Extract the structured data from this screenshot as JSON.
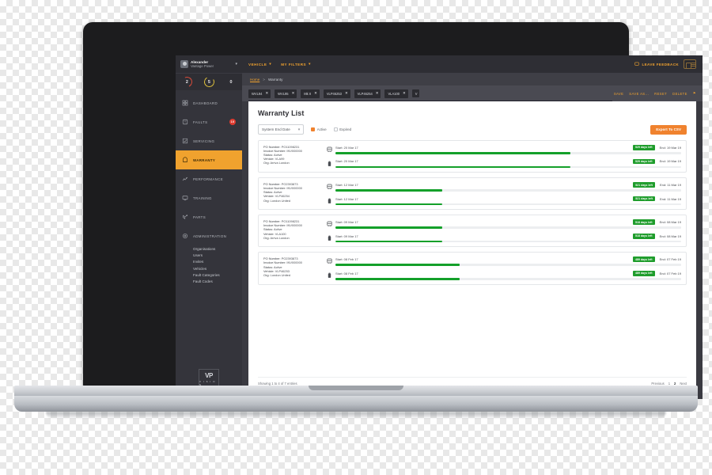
{
  "sidebar": {
    "user": {
      "name": "Alexander",
      "org": "Vantage Power",
      "caret": "chevron-down"
    },
    "gauges": [
      {
        "value": "2",
        "color": "#d94b3a"
      },
      {
        "value": "5",
        "color": "#e0c13c"
      },
      {
        "value": "0",
        "color": "#34343b"
      }
    ],
    "items": [
      {
        "label": "DASHBOARD",
        "icon": "dashboard-icon",
        "badge": ""
      },
      {
        "label": "FAULTS",
        "icon": "faults-icon",
        "badge": "10"
      },
      {
        "label": "SERVICING",
        "icon": "servicing-icon",
        "badge": ""
      },
      {
        "label": "WARRANTY",
        "icon": "warranty-icon",
        "badge": ""
      },
      {
        "label": "PERFORMANCE",
        "icon": "performance-icon",
        "badge": ""
      },
      {
        "label": "TRAINING",
        "icon": "training-icon",
        "badge": ""
      },
      {
        "label": "PARTS",
        "icon": "parts-icon",
        "badge": ""
      },
      {
        "label": "ADMINISTRATION",
        "icon": "gear-icon",
        "badge": ""
      }
    ],
    "subnav": [
      "Organisations",
      "Users",
      "Invites",
      "Vehicles",
      "Fault Categories",
      "Fault Codes"
    ],
    "logo": {
      "mark": "VP",
      "wordmark": "V I S I O N"
    }
  },
  "topbar": {
    "menus": [
      "VEHICLE",
      "MY FILTERS"
    ],
    "feedback": "LEAVE FEEDBACK"
  },
  "breadcrumb": {
    "home": "Home",
    "separator": ">",
    "current": "Warranty"
  },
  "chipbar": {
    "chips": [
      "WVL94",
      "WVL95",
      "Mk II",
      "VLP46253",
      "VLP46254",
      "VLA100",
      "V"
    ],
    "actions": [
      "SAVE",
      "SAVE AS...",
      "RESET",
      "DELETE"
    ],
    "flag_icon": "flag-icon"
  },
  "main": {
    "title": "Warranty List",
    "sort_select": {
      "value": "System End Date",
      "caret": "chevron-down"
    },
    "filters": [
      {
        "label": "Active",
        "checked": true
      },
      {
        "label": "Expired",
        "checked": false
      }
    ],
    "export_button": "Export To CSV",
    "rows": [
      {
        "po_label": "PO Number:",
        "po_value": "PO11098231",
        "invoice_label": "Invoice Number:",
        "invoice_value": "INV000000",
        "status_label": "Status:",
        "status_value": "Active",
        "vehicle_label": "Vehicle:",
        "vehicle_value": "VLA99",
        "org_label": "Org:",
        "org_value": "Arriva London",
        "bars": [
          {
            "icon": "bus-icon",
            "start": "Start: 20 Mar 17",
            "days": "529 days left",
            "end": "End: 19 Mar 19",
            "progress": 68
          },
          {
            "icon": "battery-icon",
            "start": "Start: 20 Mar 17",
            "days": "529 days left",
            "end": "End: 19 Mar 19",
            "progress": 68
          }
        ]
      },
      {
        "po_label": "PO Number:",
        "po_value": "PO2393873",
        "invoice_label": "Invoice Number:",
        "invoice_value": "INV000000",
        "status_label": "Status:",
        "status_value": "Active",
        "vehicle_label": "Vehicle:",
        "vehicle_value": "VLP46254",
        "org_label": "Org:",
        "org_value": "London United",
        "bars": [
          {
            "icon": "bus-icon",
            "start": "Start: 12 Mar 17",
            "days": "521 days left",
            "end": "End: 11 Mar 19",
            "progress": 31
          },
          {
            "icon": "battery-icon",
            "start": "Start: 12 Mar 17",
            "days": "521 days left",
            "end": "End: 11 Mar 19",
            "progress": 31
          }
        ]
      },
      {
        "po_label": "PO Number:",
        "po_value": "PO11098231",
        "invoice_label": "Invoice Number:",
        "invoice_value": "INV000000",
        "status_label": "Status:",
        "status_value": "Active",
        "vehicle_label": "Vehicle:",
        "vehicle_value": "VLA100",
        "org_label": "Org:",
        "org_value": "Arriva London",
        "bars": [
          {
            "icon": "bus-icon",
            "start": "Start: 09 Mar 17",
            "days": "518 days left",
            "end": "End: 08 Mar 19",
            "progress": 31
          },
          {
            "icon": "battery-icon",
            "start": "Start: 09 Mar 17",
            "days": "518 days left",
            "end": "End: 08 Mar 19",
            "progress": 31
          }
        ]
      },
      {
        "po_label": "PO Number:",
        "po_value": "PO2393873",
        "invoice_label": "Invoice Number:",
        "invoice_value": "INV000000",
        "status_label": "Status:",
        "status_value": "Active",
        "vehicle_label": "Vehicle:",
        "vehicle_value": "VLP46253",
        "org_label": "Org:",
        "org_value": "London United",
        "bars": [
          {
            "icon": "bus-icon",
            "start": "Start: 08 Feb 17",
            "days": "489 days left",
            "end": "End: 07 Feb 19",
            "progress": 36
          },
          {
            "icon": "battery-icon",
            "start": "Start: 08 Feb 17",
            "days": "489 days left",
            "end": "End: 07 Feb 19",
            "progress": 36
          }
        ]
      }
    ],
    "footer": {
      "entries": "Showing 1 to 4 of 7 entries",
      "previous": "Previous",
      "pages": [
        "1",
        "2"
      ],
      "current_page": "2",
      "next": "Next"
    }
  },
  "theme": {
    "accent_orange": "#f0a22e",
    "button_orange": "#f0822e",
    "green": "#14a02a",
    "red_badge": "#e03b2f",
    "sidebar_bg": "#34343b"
  }
}
